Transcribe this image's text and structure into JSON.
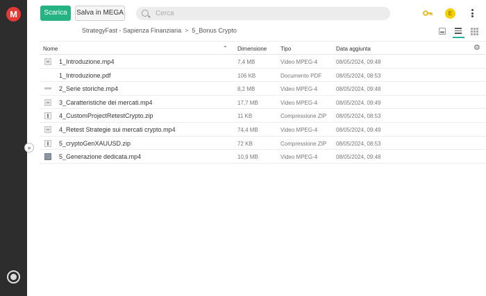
{
  "app": {
    "logo_letter": "M",
    "accent_color": "#25b384",
    "brand_color": "#e53935"
  },
  "toolbar": {
    "download_label": "Scarica",
    "save_label": "Salva in MEGA",
    "search_placeholder": "Cerca"
  },
  "account": {
    "avatar_letter": "E"
  },
  "breadcrumb": {
    "items": [
      "StrategyFast - Sapienza Finanziaria",
      "5_Bonus Crypto"
    ],
    "separator": ">"
  },
  "table": {
    "columns": {
      "name": "Nome",
      "size": "Dimensione",
      "type": "Tipo",
      "date": "Data aggiunta"
    },
    "rows": [
      {
        "name": "1_Introduzione.mp4",
        "size": "7,4 MB",
        "type": "Video MPEG-4",
        "date": "08/05/2024, 09:48",
        "icon": "video-file-icon"
      },
      {
        "name": "1_Introduzione.pdf",
        "size": "106 KB",
        "type": "Documento PDF",
        "date": "08/05/2024, 08:53",
        "icon": "pdf-file-icon"
      },
      {
        "name": "2_Serie storiche.mp4",
        "size": "8,2 MB",
        "type": "Video MPEG-4",
        "date": "08/05/2024, 09:48",
        "icon": "video-file-icon"
      },
      {
        "name": "3_Caratteristiche dei mercati.mp4",
        "size": "17,7 MB",
        "type": "Video MPEG-4",
        "date": "08/05/2024, 09:49",
        "icon": "video-file-icon"
      },
      {
        "name": "4_CustomProjectRetestCrypto.zip",
        "size": "11 KB",
        "type": "Compressione ZIP",
        "date": "08/05/2024, 08:53",
        "icon": "zip-file-icon"
      },
      {
        "name": "4_Retest Strategie sui mercati crypto.mp4",
        "size": "74,4 MB",
        "type": "Video MPEG-4",
        "date": "08/05/2024, 09:49",
        "icon": "video-file-icon"
      },
      {
        "name": "5_cryptoGenXAUUSD.zip",
        "size": "72 KB",
        "type": "Compressione ZIP",
        "date": "08/05/2024, 08:53",
        "icon": "zip-file-icon"
      },
      {
        "name": "5_Generazione dedicata.mp4",
        "size": "10,9 MB",
        "type": "Video MPEG-4",
        "date": "08/05/2024, 09:48",
        "icon": "video-file-icon"
      }
    ]
  }
}
